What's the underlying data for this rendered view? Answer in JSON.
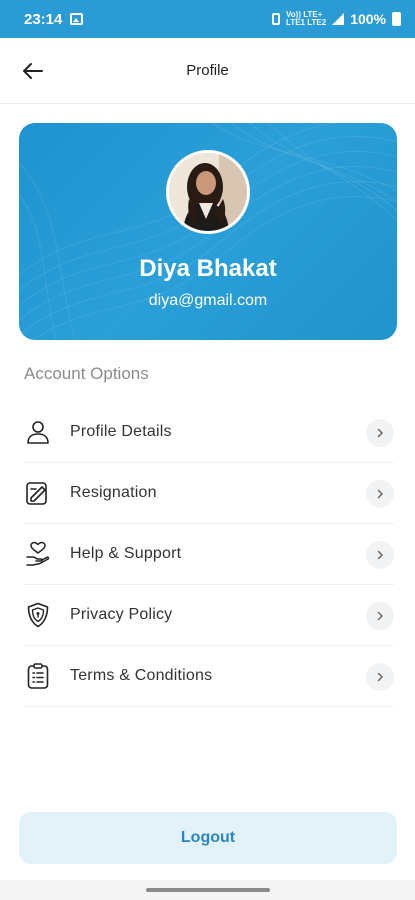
{
  "status_bar": {
    "time": "23:14",
    "network_top": "Vo)) LTE+",
    "network_bottom": "LTE1 LTE2",
    "battery": "100%"
  },
  "app_bar": {
    "title": "Profile"
  },
  "profile": {
    "name": "Diya Bhakat",
    "email": "diya@gmail.com"
  },
  "account_options": {
    "title": "Account Options",
    "items": [
      {
        "label": "Profile Details",
        "icon": "user-icon"
      },
      {
        "label": "Resignation",
        "icon": "edit-document-icon"
      },
      {
        "label": "Help & Support",
        "icon": "heart-hand-icon"
      },
      {
        "label": "Privacy Policy",
        "icon": "shield-icon"
      },
      {
        "label": "Terms & Conditions",
        "icon": "clipboard-list-icon"
      }
    ]
  },
  "logout": {
    "label": "Logout"
  },
  "colors": {
    "primary": "#2a9bd5",
    "logout_bg": "#e3f1f9",
    "logout_text": "#2a86bd"
  }
}
